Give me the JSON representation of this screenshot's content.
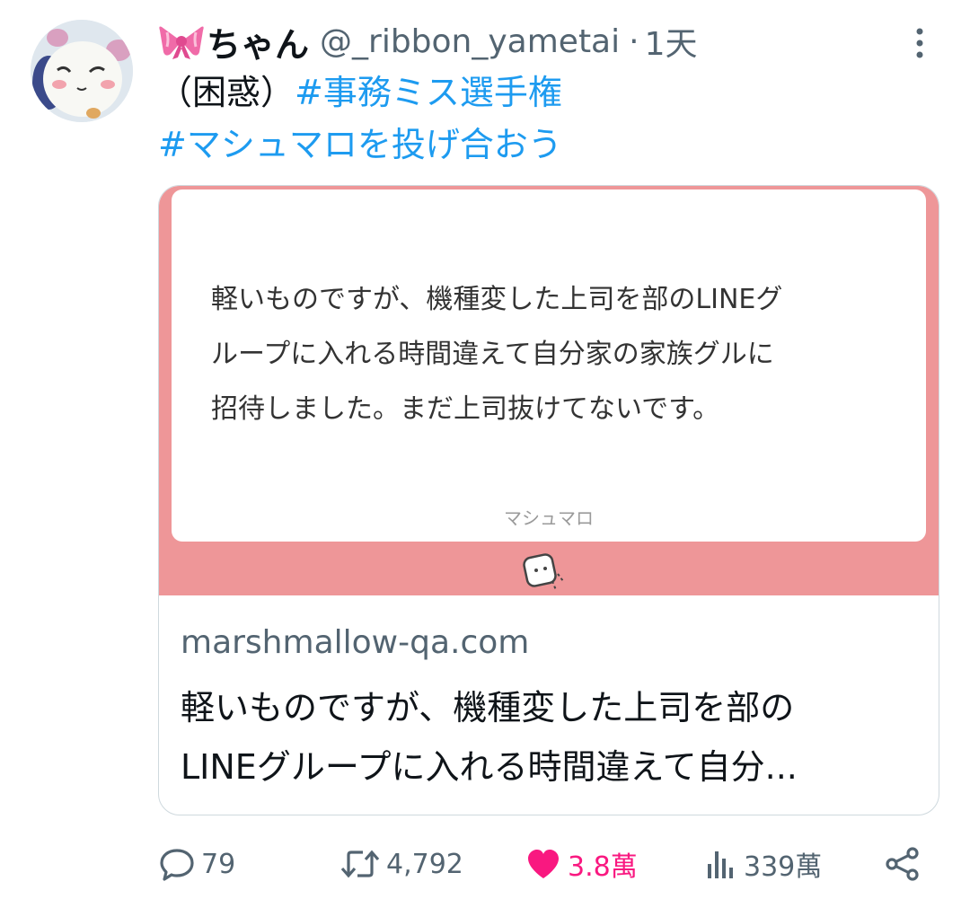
{
  "tweet": {
    "display_name": "ちゃん",
    "handle": "@_ribbon_yametai",
    "separator": "·",
    "time": "1天",
    "text_plain": "（困惑）",
    "hashtag1": "#事務ミス選手権",
    "hashtag2": "#マシュマロを投げ合おう"
  },
  "card": {
    "question": "軽いものですが、機種変した上司を部のLINEグ\nループに入れる時間違えて自分家の家族グルに\n招待しました。まだ上司抜けてないです。",
    "brand_label": "マシュマロ",
    "domain": "marshmallow-qa.com",
    "title": "軽いものですが、機種変した上司を部の\nLINEグループに入れる時間違えて自分..."
  },
  "actions": {
    "reply_count": "79",
    "retweet_count": "4,792",
    "like_count": "3.8萬",
    "views_count": "339萬"
  },
  "colors": {
    "link": "#1d9bf0",
    "secondary": "#536471",
    "like": "#f91880",
    "card_pink": "#ee9698"
  },
  "icons": [
    "ribbon-icon",
    "more-icon",
    "marshmallow-icon",
    "reply-icon",
    "retweet-icon",
    "heart-icon",
    "views-icon",
    "share-icon"
  ]
}
